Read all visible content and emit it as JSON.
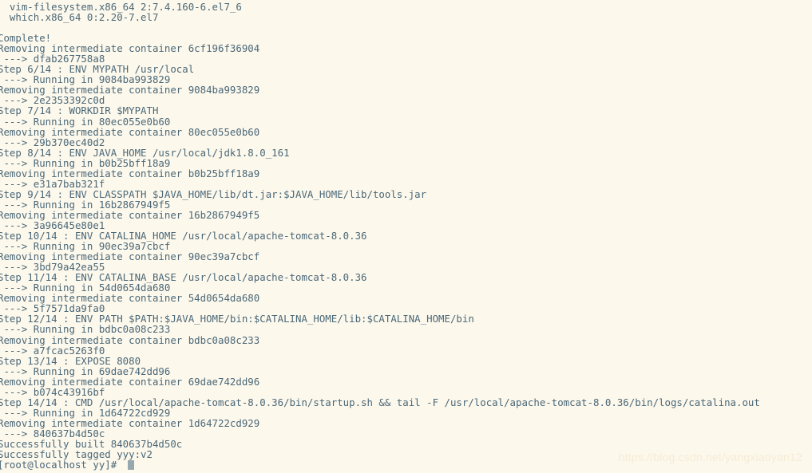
{
  "terminal": {
    "background_color": "#fdf8ec",
    "text_color": "#4a6878",
    "cursor_color": "#96a8ae",
    "prompt": "[root@localhost yy]# ",
    "lines": [
      "  vim-filesystem.x86_64 2:7.4.160-6.el7_6",
      "  which.x86_64 0:2.20-7.el7",
      "",
      "Complete!",
      "Removing intermediate container 6cf196f36904",
      " ---> dfab267758a8",
      "Step 6/14 : ENV MYPATH /usr/local",
      " ---> Running in 9084ba993829",
      "Removing intermediate container 9084ba993829",
      " ---> 2e2353392c0d",
      "Step 7/14 : WORKDIR $MYPATH",
      " ---> Running in 80ec055e0b60",
      "Removing intermediate container 80ec055e0b60",
      " ---> 29b370ec40d2",
      "Step 8/14 : ENV JAVA_HOME /usr/local/jdk1.8.0_161",
      " ---> Running in b0b25bff18a9",
      "Removing intermediate container b0b25bff18a9",
      " ---> e31a7bab321f",
      "Step 9/14 : ENV CLASSPATH $JAVA_HOME/lib/dt.jar:$JAVA_HOME/lib/tools.jar",
      " ---> Running in 16b2867949f5",
      "Removing intermediate container 16b2867949f5",
      " ---> 3a96645e80e1",
      "Step 10/14 : ENV CATALINA_HOME /usr/local/apache-tomcat-8.0.36",
      " ---> Running in 90ec39a7cbcf",
      "Removing intermediate container 90ec39a7cbcf",
      " ---> 3bd79a42ea55",
      "Step 11/14 : ENV CATALINA_BASE /usr/local/apache-tomcat-8.0.36",
      " ---> Running in 54d0654da680",
      "Removing intermediate container 54d0654da680",
      " ---> 5f7571da9fa0",
      "Step 12/14 : ENV PATH $PATH:$JAVA_HOME/bin:$CATALINA_HOME/lib:$CATALINA_HOME/bin",
      " ---> Running in bdbc0a08c233",
      "Removing intermediate container bdbc0a08c233",
      " ---> a7fcac5263f0",
      "Step 13/14 : EXPOSE 8080",
      " ---> Running in 69dae742dd96",
      "Removing intermediate container 69dae742dd96",
      " ---> b074c43916bf",
      "Step 14/14 : CMD /usr/local/apache-tomcat-8.0.36/bin/startup.sh && tail -F /usr/local/apache-tomcat-8.0.36/bin/logs/catalina.out",
      " ---> Running in 1d64722cd929",
      "Removing intermediate container 1d64722cd929",
      " ---> 840637b4d50c",
      "Successfully built 840637b4d50c",
      "Successfully tagged yyy:v2"
    ]
  },
  "watermark": {
    "text": "https://blog.csdn.net/yangxiaoyan12",
    "color": "#f5ecd6"
  }
}
